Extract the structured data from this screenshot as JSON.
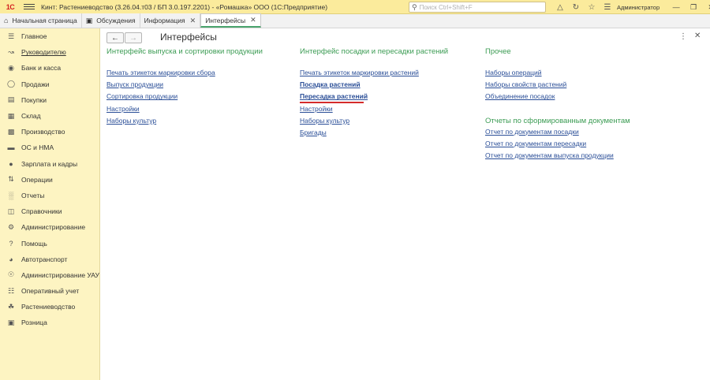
{
  "window": {
    "logo": "1С",
    "title": "Кинт: Растениеводство (3.26.04.т03 / БП 3.0.197.2201) - «Ромашка» ООО  (1С:Предприятие)",
    "search_placeholder": "Поиск Ctrl+Shift+F",
    "user": "Администратор"
  },
  "tabs": [
    {
      "label": "Начальная страница"
    },
    {
      "label": "Обсуждения"
    },
    {
      "label": "Информация"
    },
    {
      "label": "Интерфейсы"
    }
  ],
  "sidebar": {
    "items": [
      {
        "label": "Главное"
      },
      {
        "label": "Руководителю"
      },
      {
        "label": "Банк и касса"
      },
      {
        "label": "Продажи"
      },
      {
        "label": "Покупки"
      },
      {
        "label": "Склад"
      },
      {
        "label": "Производство"
      },
      {
        "label": "ОС и НМА"
      },
      {
        "label": "Зарплата и кадры"
      },
      {
        "label": "Операции"
      },
      {
        "label": "Отчеты"
      },
      {
        "label": "Справочники"
      },
      {
        "label": "Администрирование"
      },
      {
        "label": "Помощь"
      },
      {
        "label": "Автотранспорт"
      },
      {
        "label": "Администрирование УАУ"
      },
      {
        "label": "Оперативный учет"
      },
      {
        "label": "Растениеводство"
      },
      {
        "label": "Розница"
      }
    ]
  },
  "page": {
    "title": "Интерфейсы",
    "columns": [
      {
        "heading": "Интерфейс выпуска и сортировки продукции",
        "links": [
          "Печать этикеток маркировки сбора",
          "Выпуск продукции",
          "Сортировка продукции",
          "Настройки",
          "Наборы культур"
        ]
      },
      {
        "heading": "Интерфейс посадки и пересадки растений",
        "links": [
          "Печать этикеток маркировки растений",
          "Посадка растений",
          "Пересадка растений",
          "Настройки",
          "Наборы культур",
          "Бригады"
        ]
      },
      {
        "heading": "Прочее",
        "links": [
          "Наборы операций",
          "Наборы свойств растений",
          "Объединение посадок"
        ],
        "heading2": "Отчеты по сформированным документам",
        "links2": [
          "Отчет по документам посадки",
          "Отчет по документам пересадки",
          "Отчет по документам выпуска продукции"
        ]
      }
    ]
  },
  "colors": {
    "sidebar_bg": "#fdf4c2",
    "titlebar_bg": "#fbeb9c",
    "heading": "#3c9c54",
    "link": "#2a4e97",
    "accent_underline": "#d42b2b"
  }
}
